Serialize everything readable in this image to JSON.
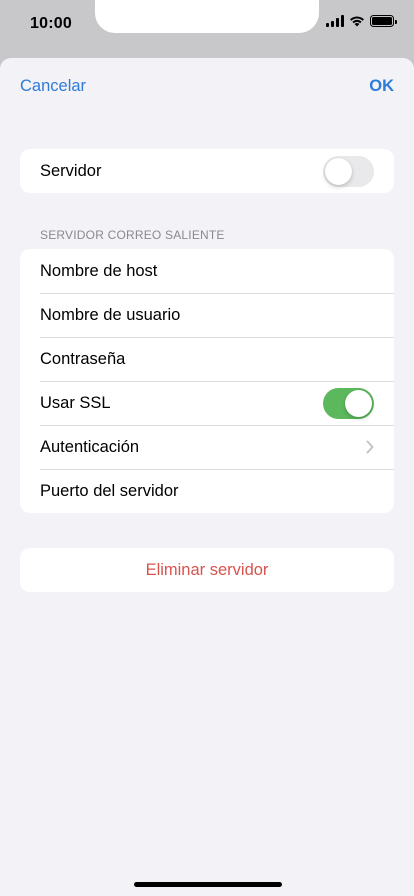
{
  "status_bar": {
    "time": "10:00"
  },
  "navbar": {
    "cancel_label": "Cancelar",
    "ok_label": "OK"
  },
  "server_group": {
    "label": "Servidor",
    "toggle_on": false
  },
  "outgoing": {
    "header": "SERVIDOR CORREO SALIENTE",
    "rows": [
      {
        "label": "Nombre de host"
      },
      {
        "label": "Nombre de usuario"
      },
      {
        "label": "Contraseña"
      },
      {
        "label": "Usar SSL",
        "toggle_on": true
      },
      {
        "label": "Autenticación",
        "chevron": true
      },
      {
        "label": "Puerto del servidor"
      }
    ]
  },
  "delete": {
    "label": "Eliminar servidor"
  },
  "colors": {
    "accent": "#2f7bd8",
    "destructive": "#d9534f",
    "toggle_on": "#5cb85c",
    "toggle_off": "#e9e9eb",
    "background": "#f2f2f7"
  },
  "icons": [
    "signal-icon",
    "wifi-icon",
    "battery-icon",
    "chevron-right-icon"
  ]
}
